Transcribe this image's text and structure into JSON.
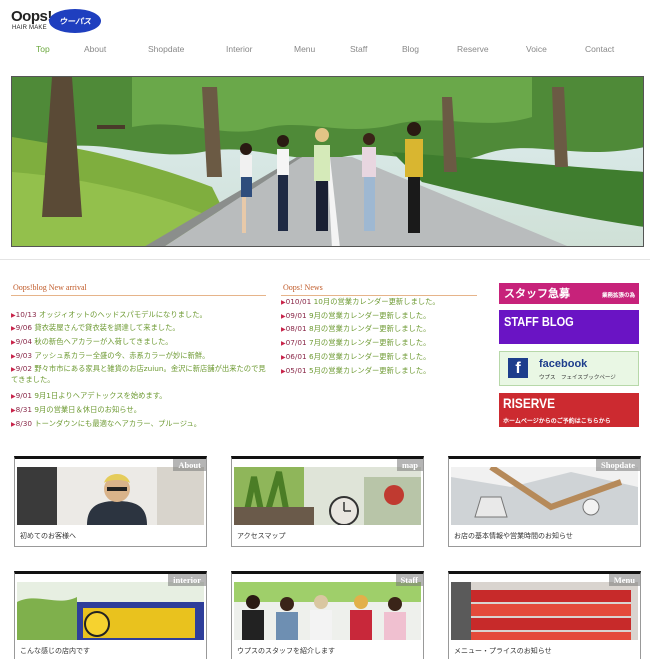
{
  "header": {
    "logo_text": "Oops!",
    "logo_sub": "HAIR MAKE",
    "logo_badge": "ウーパス"
  },
  "nav": {
    "items": [
      "Top",
      "About",
      "Shopdate",
      "Interior",
      "Menu",
      "Staff",
      "Blog",
      "Reserve",
      "Voice",
      "Contact"
    ],
    "active": "Top"
  },
  "blog": {
    "title": "Oops!blog New arrival",
    "items": [
      {
        "date": "10/13",
        "text": "オッジィオットのヘッドスパモデルになりました。"
      },
      {
        "date": "9/06",
        "text": "貸衣装屋さんで貸衣装を調達して来ました。"
      },
      {
        "date": "9/04",
        "text": "秋の新色ヘアカラーが入荷してきました。"
      },
      {
        "date": "9/03",
        "text": "アッシュ系カラー全盛の今、赤系カラーが妙に新鮮。"
      },
      {
        "date": "9/02",
        "text": "野々市市にある家具と雑貨のお店zuiun。金沢に新店舗が出来たので見てきました。"
      },
      {
        "date": "9/01",
        "text": "9月1日よりヘアデトックスを始めます。"
      },
      {
        "date": "8/31",
        "text": "9月の営業日＆休日のお知らせ。"
      },
      {
        "date": "8/30",
        "text": "トーンダウンにも最適なヘアカラー、プルージュ。"
      }
    ]
  },
  "news": {
    "title": "Oops! News",
    "items": [
      {
        "date": "010/01",
        "text": "10月の営業カレンダー更新しました。"
      },
      {
        "date": "09/01",
        "text": "9月の営業カレンダー更新しました。"
      },
      {
        "date": "08/01",
        "text": "8月の営業カレンダー更新しました。"
      },
      {
        "date": "07/01",
        "text": "7月の営業カレンダー更新しました。"
      },
      {
        "date": "06/01",
        "text": "6月の営業カレンダー更新しました。"
      },
      {
        "date": "05/01",
        "text": "5月の営業カレンダー更新しました。"
      }
    ]
  },
  "banners": {
    "staff_wanted": {
      "big": "スタッフ急募",
      "small": "業務拡張の為"
    },
    "staff_blog": {
      "big": "STAFF BLOG"
    },
    "facebook": {
      "big": "facebook",
      "small": "ウプス　フェイスブックページ"
    },
    "reserve": {
      "big": "RISERVE",
      "small": "ホームページからのご予約はこちらから"
    }
  },
  "cards": [
    {
      "label": "About",
      "caption": "初めてのお客様へ"
    },
    {
      "label": "map",
      "caption": "アクセスマップ"
    },
    {
      "label": "Shopdate",
      "caption": "お店の基本情報や営業時間のお知らせ"
    },
    {
      "label": "interior",
      "caption": "こんな感じの店内です"
    },
    {
      "label": "Staff",
      "caption": "ウプスのスタッフを紹介します"
    },
    {
      "label": "Menu",
      "caption": "メニュー・プライスのお知らせ"
    }
  ],
  "colors": {
    "nav_active": "#6ba83e",
    "news_text": "#6d9a32",
    "title_orange": "#c05a28",
    "staff_banner": "#c7227a",
    "blog_banner": "#6a14c4",
    "reserve_banner": "#cc2a30"
  }
}
